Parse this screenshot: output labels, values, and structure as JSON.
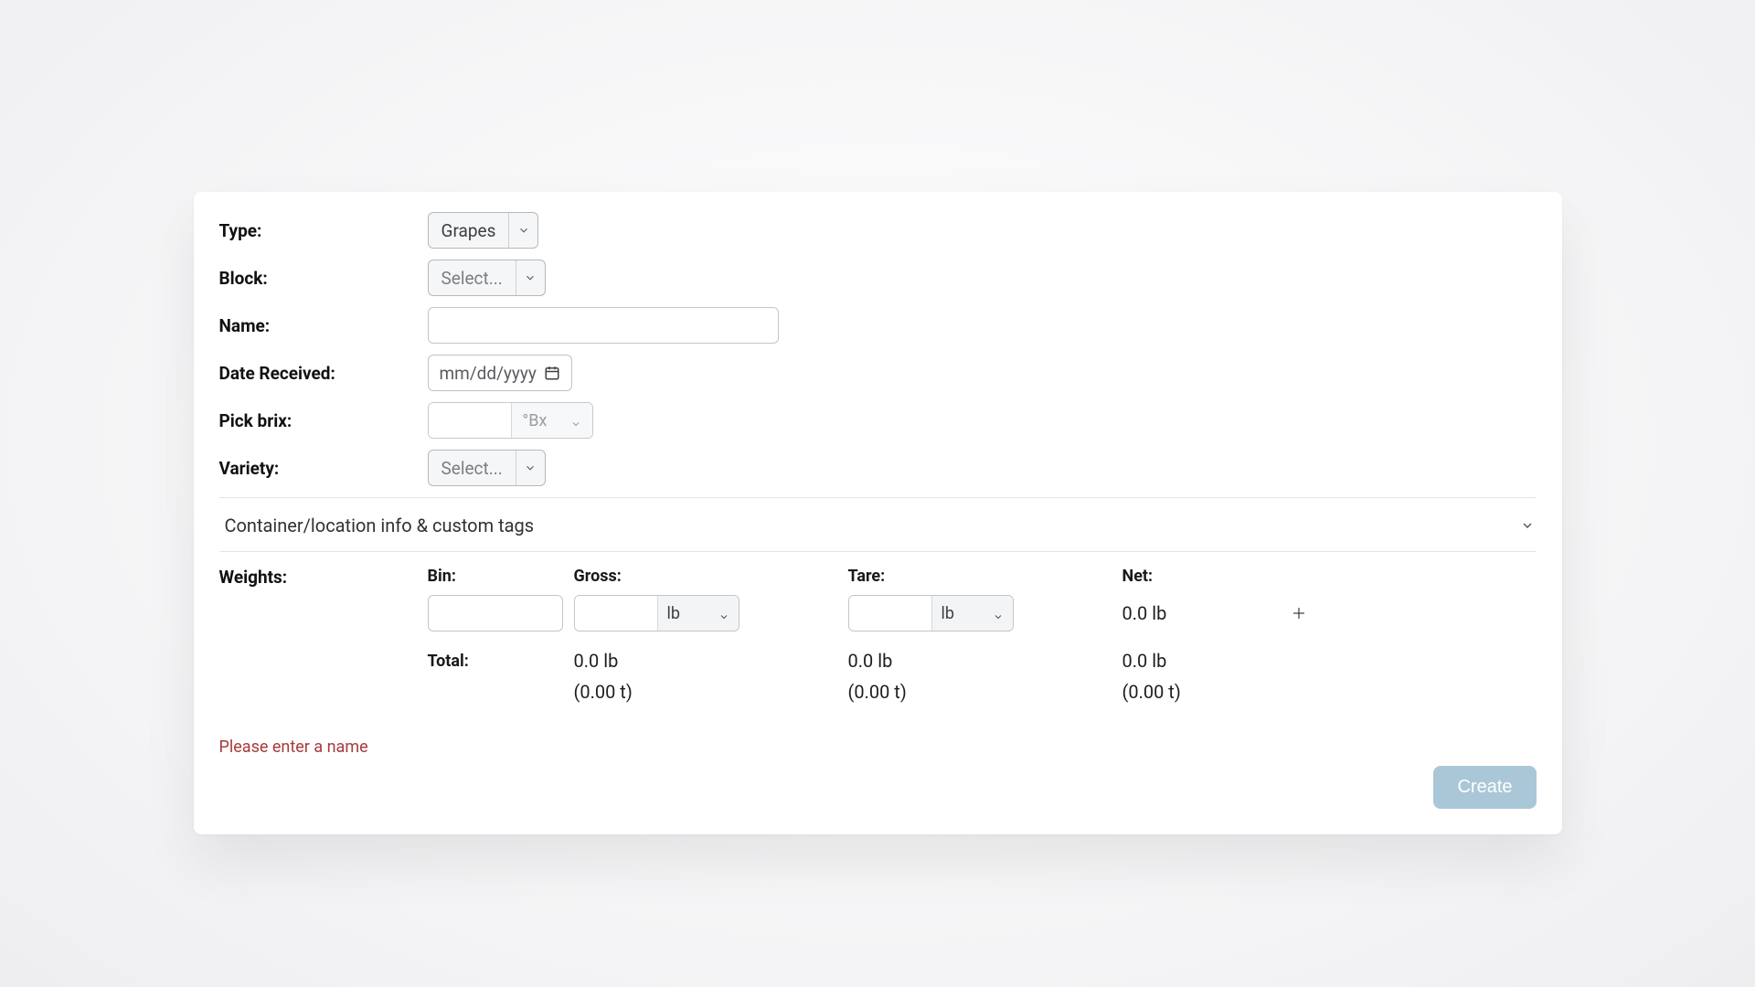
{
  "form": {
    "type": {
      "label": "Type:",
      "value": "Grapes"
    },
    "block": {
      "label": "Block:",
      "placeholder": "Select..."
    },
    "name": {
      "label": "Name:",
      "value": ""
    },
    "date_received": {
      "label": "Date Received:",
      "placeholder": "mm/dd/yyyy"
    },
    "pick_brix": {
      "label": "Pick brix:",
      "unit": "°Bx",
      "value": ""
    },
    "variety": {
      "label": "Variety:",
      "placeholder": "Select..."
    }
  },
  "accordion": {
    "container_title": "Container/location info & custom tags"
  },
  "weights": {
    "section_label": "Weights:",
    "headers": {
      "bin": "Bin:",
      "gross": "Gross:",
      "tare": "Tare:",
      "net": "Net:"
    },
    "row": {
      "bin": "",
      "gross_value": "",
      "gross_unit": "lb",
      "tare_value": "",
      "tare_unit": "lb",
      "net": "0.0 lb"
    },
    "totals": {
      "label": "Total:",
      "gross": "0.0 lb",
      "tare": "0.0 lb",
      "net": "0.0 lb",
      "gross_t": "(0.00 t)",
      "tare_t": "(0.00 t)",
      "net_t": "(0.00 t)"
    }
  },
  "footer": {
    "error": "Please enter a name",
    "create_label": "Create"
  }
}
